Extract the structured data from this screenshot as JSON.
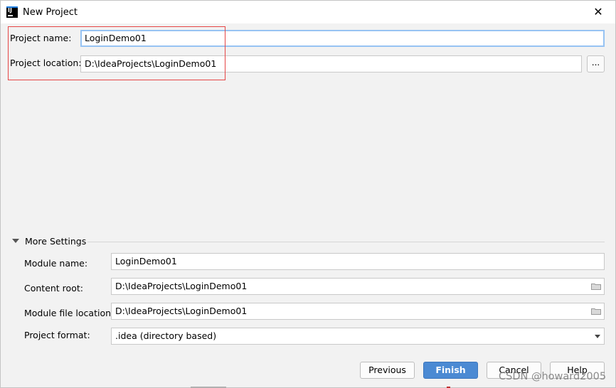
{
  "window": {
    "title": "New Project",
    "icon": "intellij-icon",
    "close_icon": "close-icon"
  },
  "project": {
    "name_label": "Project name:",
    "name_value": "LoginDemo01",
    "location_label": "Project location:",
    "location_value": "D:\\IdeaProjects\\LoginDemo01",
    "browse_label": "..."
  },
  "more_settings": {
    "title": "More Settings",
    "module_name_label": "Module name:",
    "module_name_value": "LoginDemo01",
    "content_root_label": "Content root:",
    "content_root_value": "D:\\IdeaProjects\\LoginDemo01",
    "module_file_location_label": "Module file location:",
    "module_file_location_value": "D:\\IdeaProjects\\LoginDemo01",
    "project_format_label": "Project format:",
    "project_format_value": ".idea (directory based)"
  },
  "buttons": {
    "previous": "Previous",
    "finish": "Finish",
    "cancel": "Cancel",
    "help": "Help"
  },
  "watermark": "CSDN @howard2005",
  "colors": {
    "highlight": "#e64646",
    "primary": "#4b8ad3",
    "focus": "#97c3f3"
  }
}
